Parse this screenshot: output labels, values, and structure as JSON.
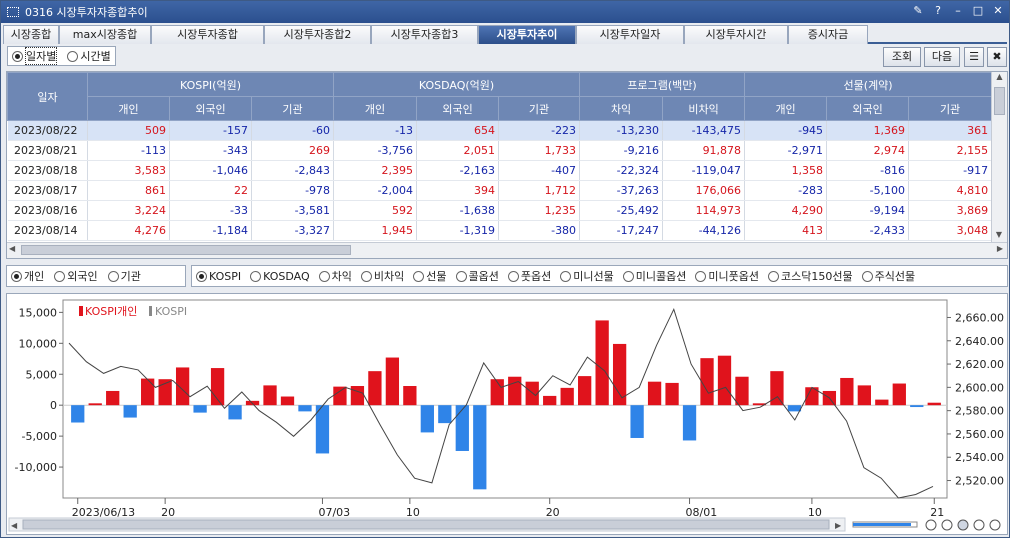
{
  "window": {
    "title": "0316 시장투자자종합추이",
    "controls": [
      "pin-icon",
      "help-icon",
      "minimize-icon",
      "maximize-icon",
      "close-icon"
    ]
  },
  "tabs": [
    "시장종합",
    "max시장종합",
    "시장투자종합",
    "시장투자종합2",
    "시장투자종합3",
    "시장투자추이",
    "시장투자일자",
    "시장투자시간",
    "증시자금"
  ],
  "active_tab": 5,
  "view_modes": {
    "daily": "일자별",
    "hourly": "시간별"
  },
  "buttons": {
    "search": "조회",
    "next": "다음"
  },
  "table": {
    "date_header": "일자",
    "groups": [
      "KOSPI(억원)",
      "KOSDAQ(억원)",
      "프로그램(백만)",
      "선물(계약)"
    ],
    "columns": [
      "개인",
      "외국인",
      "기관",
      "개인",
      "외국인",
      "기관",
      "차익",
      "비차익",
      "개인",
      "외국인",
      "기관"
    ],
    "rows": [
      {
        "date": "2023/08/22",
        "values": [
          "509",
          "-157",
          "-60",
          "-13",
          "654",
          "-223",
          "-13,230",
          "-143,475",
          "-945",
          "1,369",
          "361"
        ]
      },
      {
        "date": "2023/08/21",
        "values": [
          "-113",
          "-343",
          "269",
          "-3,756",
          "2,051",
          "1,733",
          "-9,216",
          "91,878",
          "-2,971",
          "2,974",
          "2,155"
        ]
      },
      {
        "date": "2023/08/18",
        "values": [
          "3,583",
          "-1,046",
          "-2,843",
          "2,395",
          "-2,163",
          "-407",
          "-22,324",
          "-119,047",
          "1,358",
          "-816",
          "-917"
        ]
      },
      {
        "date": "2023/08/17",
        "values": [
          "861",
          "22",
          "-978",
          "-2,004",
          "394",
          "1,712",
          "-37,263",
          "176,066",
          "-283",
          "-5,100",
          "4,810"
        ]
      },
      {
        "date": "2023/08/16",
        "values": [
          "3,224",
          "-33",
          "-3,581",
          "592",
          "-1,638",
          "1,235",
          "-25,492",
          "114,973",
          "4,290",
          "-9,194",
          "3,869"
        ]
      },
      {
        "date": "2023/08/14",
        "values": [
          "4,276",
          "-1,184",
          "-3,327",
          "1,945",
          "-1,319",
          "-380",
          "-17,247",
          "-44,126",
          "413",
          "-2,433",
          "3,048"
        ]
      }
    ]
  },
  "investor_radio": {
    "items": [
      "개인",
      "외국인",
      "기관"
    ],
    "selected": 0
  },
  "market_radio": {
    "items": [
      "KOSPI",
      "KOSDAQ",
      "차익",
      "비차익",
      "선물",
      "콜옵션",
      "풋옵션",
      "미니선물",
      "미니콜옵션",
      "미니풋옵션",
      "코스닥150선물",
      "주식선물"
    ],
    "selected": 0
  },
  "chart_data": {
    "type": "bar",
    "legend": [
      "KOSPI개인",
      "KOSPI"
    ],
    "legend_placement": "top-left",
    "y_left": {
      "ticks": [
        "15,000",
        "10,000",
        "5,000",
        "0",
        "-5,000",
        "-10,000"
      ],
      "range": [
        -15000,
        17000
      ]
    },
    "y_right": {
      "ticks": [
        "2,660.00",
        "2,640.00",
        "2,620.00",
        "2,600.00",
        "2,580.00",
        "2,560.00",
        "2,540.00",
        "2,520.00"
      ],
      "range": [
        2505,
        2675
      ]
    },
    "x_labels": [
      {
        "label": "2023/06/13",
        "index": 0
      },
      {
        "label": "20",
        "index": 5
      },
      {
        "label": "07/03",
        "index": 14
      },
      {
        "label": "10",
        "index": 19
      },
      {
        "label": "20",
        "index": 27
      },
      {
        "label": "08/01",
        "index": 35
      },
      {
        "label": "10",
        "index": 42
      },
      {
        "label": "21",
        "index": 49
      }
    ],
    "series": [
      {
        "name": "KOSPI개인",
        "color": "#e0131c",
        "neg_color": "#2f84e8",
        "values": [
          -2800,
          300,
          2300,
          -2000,
          4300,
          4200,
          6100,
          -1200,
          6000,
          -2300,
          700,
          3200,
          1400,
          -1000,
          -7800,
          3000,
          3100,
          5500,
          7700,
          3100,
          -4400,
          -2900,
          -7400,
          -13600,
          4200,
          4600,
          3800,
          1500,
          2800,
          4700,
          13700,
          9900,
          -5300,
          3800,
          3600,
          -5700,
          7600,
          8000,
          4600,
          300,
          5500,
          -1000,
          2900,
          2300,
          4400,
          3200,
          900,
          3500,
          -300,
          400
        ]
      },
      {
        "name": "KOSPI",
        "color": "#444444",
        "values": [
          2638,
          2622,
          2612,
          2618,
          2615,
          2600,
          2606,
          2592,
          2601,
          2582,
          2596,
          2580,
          2570,
          2558,
          2572,
          2590,
          2600,
          2595,
          2568,
          2542,
          2522,
          2518,
          2568,
          2585,
          2621,
          2600,
          2605,
          2593,
          2610,
          2602,
          2626,
          2614,
          2591,
          2600,
          2636,
          2667,
          2620,
          2595,
          2600,
          2580,
          2583,
          2592,
          2572,
          2600,
          2591,
          2571,
          2531,
          2522,
          2505,
          2508,
          2515
        ]
      }
    ]
  }
}
